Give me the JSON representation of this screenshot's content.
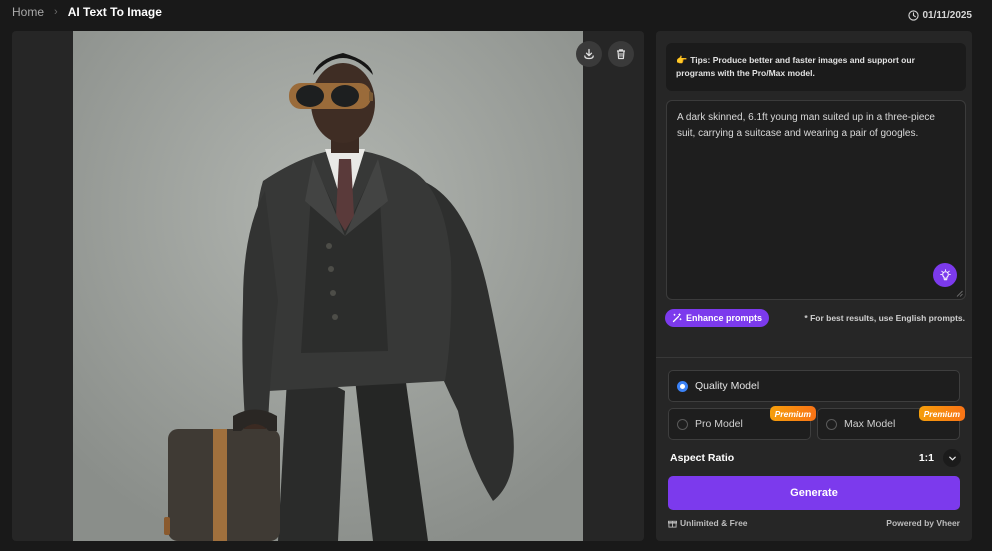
{
  "breadcrumb": {
    "home": "Home",
    "separator": "›",
    "current": "AI Text To Image"
  },
  "header": {
    "date": "01/11/2025",
    "date_icon": "clock-icon"
  },
  "preview": {
    "image_alt": "Man in a three-piece suit with goggles and a suitcase",
    "actions": [
      {
        "icon": "download-icon"
      },
      {
        "icon": "trash-icon"
      }
    ]
  },
  "tips": {
    "emoji": "👉",
    "text": "Tips: Produce better and faster images and support our programs with the Pro/Max model."
  },
  "prompt": {
    "value": "A dark skinned, 6.1ft young man suited up in a three-piece suit, carrying a suitcase and wearing a pair of googles.",
    "icon": "lightbulb-icon"
  },
  "enhance": {
    "label": "Enhance prompts",
    "icon": "magic-wand-icon"
  },
  "note": "* For best results, use English prompts.",
  "models": {
    "quality": {
      "label": "Quality Model",
      "selected": true
    },
    "pro": {
      "label": "Pro Model",
      "badge": "Premium",
      "selected": false
    },
    "max": {
      "label": "Max Model",
      "badge": "Premium",
      "selected": false
    }
  },
  "aspect": {
    "label": "Aspect Ratio",
    "value": "1:1"
  },
  "generate": {
    "label": "Generate"
  },
  "footer": {
    "left": "Unlimited & Free",
    "right": "Powered by Vheer"
  },
  "colors": {
    "accent": "#7c3aed",
    "radio_selected": "#3b82f6",
    "premium": "#f59e0b",
    "background": "#191919",
    "panel": "#262626"
  }
}
